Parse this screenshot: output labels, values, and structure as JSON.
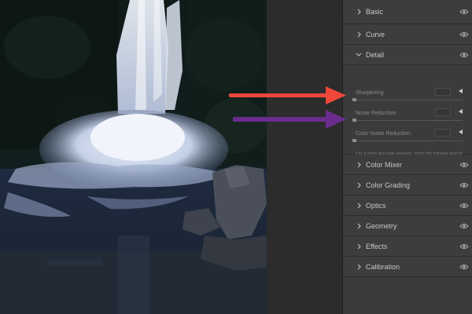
{
  "panel": {
    "sections_top": [
      {
        "label": "Basic",
        "expanded": false
      },
      {
        "label": "Curve",
        "expanded": false
      },
      {
        "label": "Detail",
        "expanded": true
      }
    ],
    "detail": {
      "controls": [
        {
          "label": "Sharpening",
          "value": 0
        },
        {
          "label": "Noise Reduction",
          "value": 0
        },
        {
          "label": "Color Noise Reduction",
          "value": 0
        }
      ],
      "hint": "For a more accurate preview, zoom the preview size to 100% or larger when adjusting the controls in this panel."
    },
    "sections_bottom": [
      {
        "label": "Color Mixer",
        "expanded": false
      },
      {
        "label": "Color Grading",
        "expanded": false
      },
      {
        "label": "Optics",
        "expanded": false
      },
      {
        "label": "Geometry",
        "expanded": false
      },
      {
        "label": "Effects",
        "expanded": false
      },
      {
        "label": "Calibration",
        "expanded": false
      }
    ]
  },
  "icons": {
    "collapsed": "chevron-right-icon",
    "expanded": "chevron-down-icon",
    "visibility": "eye-icon",
    "reset": "triangle-left-icon"
  },
  "annotations": {
    "noise_reduction_arrow_color": "#f0473b",
    "color_noise_reduction_arrow_color": "#6a2d8f"
  },
  "colors": {
    "panel_bg": "#3b3b3b",
    "label_text": "#c8c8c8",
    "muted_text": "#8a8a8a"
  }
}
